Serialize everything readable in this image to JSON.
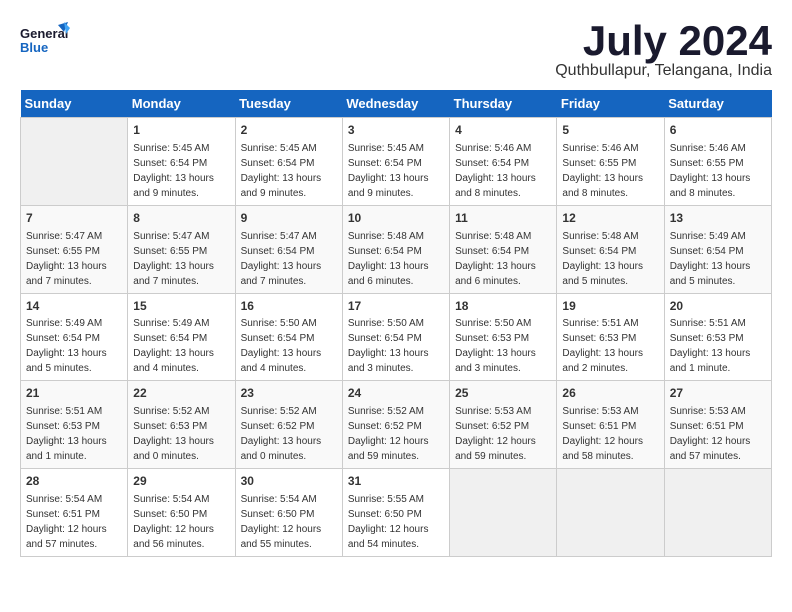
{
  "header": {
    "logo_line1": "General",
    "logo_line2": "Blue",
    "month": "July 2024",
    "location": "Quthbullapur, Telangana, India"
  },
  "days_of_week": [
    "Sunday",
    "Monday",
    "Tuesday",
    "Wednesday",
    "Thursday",
    "Friday",
    "Saturday"
  ],
  "weeks": [
    [
      {
        "day": "",
        "info": ""
      },
      {
        "day": "1",
        "info": "Sunrise: 5:45 AM\nSunset: 6:54 PM\nDaylight: 13 hours\nand 9 minutes."
      },
      {
        "day": "2",
        "info": "Sunrise: 5:45 AM\nSunset: 6:54 PM\nDaylight: 13 hours\nand 9 minutes."
      },
      {
        "day": "3",
        "info": "Sunrise: 5:45 AM\nSunset: 6:54 PM\nDaylight: 13 hours\nand 9 minutes."
      },
      {
        "day": "4",
        "info": "Sunrise: 5:46 AM\nSunset: 6:54 PM\nDaylight: 13 hours\nand 8 minutes."
      },
      {
        "day": "5",
        "info": "Sunrise: 5:46 AM\nSunset: 6:55 PM\nDaylight: 13 hours\nand 8 minutes."
      },
      {
        "day": "6",
        "info": "Sunrise: 5:46 AM\nSunset: 6:55 PM\nDaylight: 13 hours\nand 8 minutes."
      }
    ],
    [
      {
        "day": "7",
        "info": "Sunrise: 5:47 AM\nSunset: 6:55 PM\nDaylight: 13 hours\nand 7 minutes."
      },
      {
        "day": "8",
        "info": "Sunrise: 5:47 AM\nSunset: 6:55 PM\nDaylight: 13 hours\nand 7 minutes."
      },
      {
        "day": "9",
        "info": "Sunrise: 5:47 AM\nSunset: 6:54 PM\nDaylight: 13 hours\nand 7 minutes."
      },
      {
        "day": "10",
        "info": "Sunrise: 5:48 AM\nSunset: 6:54 PM\nDaylight: 13 hours\nand 6 minutes."
      },
      {
        "day": "11",
        "info": "Sunrise: 5:48 AM\nSunset: 6:54 PM\nDaylight: 13 hours\nand 6 minutes."
      },
      {
        "day": "12",
        "info": "Sunrise: 5:48 AM\nSunset: 6:54 PM\nDaylight: 13 hours\nand 5 minutes."
      },
      {
        "day": "13",
        "info": "Sunrise: 5:49 AM\nSunset: 6:54 PM\nDaylight: 13 hours\nand 5 minutes."
      }
    ],
    [
      {
        "day": "14",
        "info": "Sunrise: 5:49 AM\nSunset: 6:54 PM\nDaylight: 13 hours\nand 5 minutes."
      },
      {
        "day": "15",
        "info": "Sunrise: 5:49 AM\nSunset: 6:54 PM\nDaylight: 13 hours\nand 4 minutes."
      },
      {
        "day": "16",
        "info": "Sunrise: 5:50 AM\nSunset: 6:54 PM\nDaylight: 13 hours\nand 4 minutes."
      },
      {
        "day": "17",
        "info": "Sunrise: 5:50 AM\nSunset: 6:54 PM\nDaylight: 13 hours\nand 3 minutes."
      },
      {
        "day": "18",
        "info": "Sunrise: 5:50 AM\nSunset: 6:53 PM\nDaylight: 13 hours\nand 3 minutes."
      },
      {
        "day": "19",
        "info": "Sunrise: 5:51 AM\nSunset: 6:53 PM\nDaylight: 13 hours\nand 2 minutes."
      },
      {
        "day": "20",
        "info": "Sunrise: 5:51 AM\nSunset: 6:53 PM\nDaylight: 13 hours\nand 1 minute."
      }
    ],
    [
      {
        "day": "21",
        "info": "Sunrise: 5:51 AM\nSunset: 6:53 PM\nDaylight: 13 hours\nand 1 minute."
      },
      {
        "day": "22",
        "info": "Sunrise: 5:52 AM\nSunset: 6:53 PM\nDaylight: 13 hours\nand 0 minutes."
      },
      {
        "day": "23",
        "info": "Sunrise: 5:52 AM\nSunset: 6:52 PM\nDaylight: 13 hours\nand 0 minutes."
      },
      {
        "day": "24",
        "info": "Sunrise: 5:52 AM\nSunset: 6:52 PM\nDaylight: 12 hours\nand 59 minutes."
      },
      {
        "day": "25",
        "info": "Sunrise: 5:53 AM\nSunset: 6:52 PM\nDaylight: 12 hours\nand 59 minutes."
      },
      {
        "day": "26",
        "info": "Sunrise: 5:53 AM\nSunset: 6:51 PM\nDaylight: 12 hours\nand 58 minutes."
      },
      {
        "day": "27",
        "info": "Sunrise: 5:53 AM\nSunset: 6:51 PM\nDaylight: 12 hours\nand 57 minutes."
      }
    ],
    [
      {
        "day": "28",
        "info": "Sunrise: 5:54 AM\nSunset: 6:51 PM\nDaylight: 12 hours\nand 57 minutes."
      },
      {
        "day": "29",
        "info": "Sunrise: 5:54 AM\nSunset: 6:50 PM\nDaylight: 12 hours\nand 56 minutes."
      },
      {
        "day": "30",
        "info": "Sunrise: 5:54 AM\nSunset: 6:50 PM\nDaylight: 12 hours\nand 55 minutes."
      },
      {
        "day": "31",
        "info": "Sunrise: 5:55 AM\nSunset: 6:50 PM\nDaylight: 12 hours\nand 54 minutes."
      },
      {
        "day": "",
        "info": ""
      },
      {
        "day": "",
        "info": ""
      },
      {
        "day": "",
        "info": ""
      }
    ]
  ]
}
